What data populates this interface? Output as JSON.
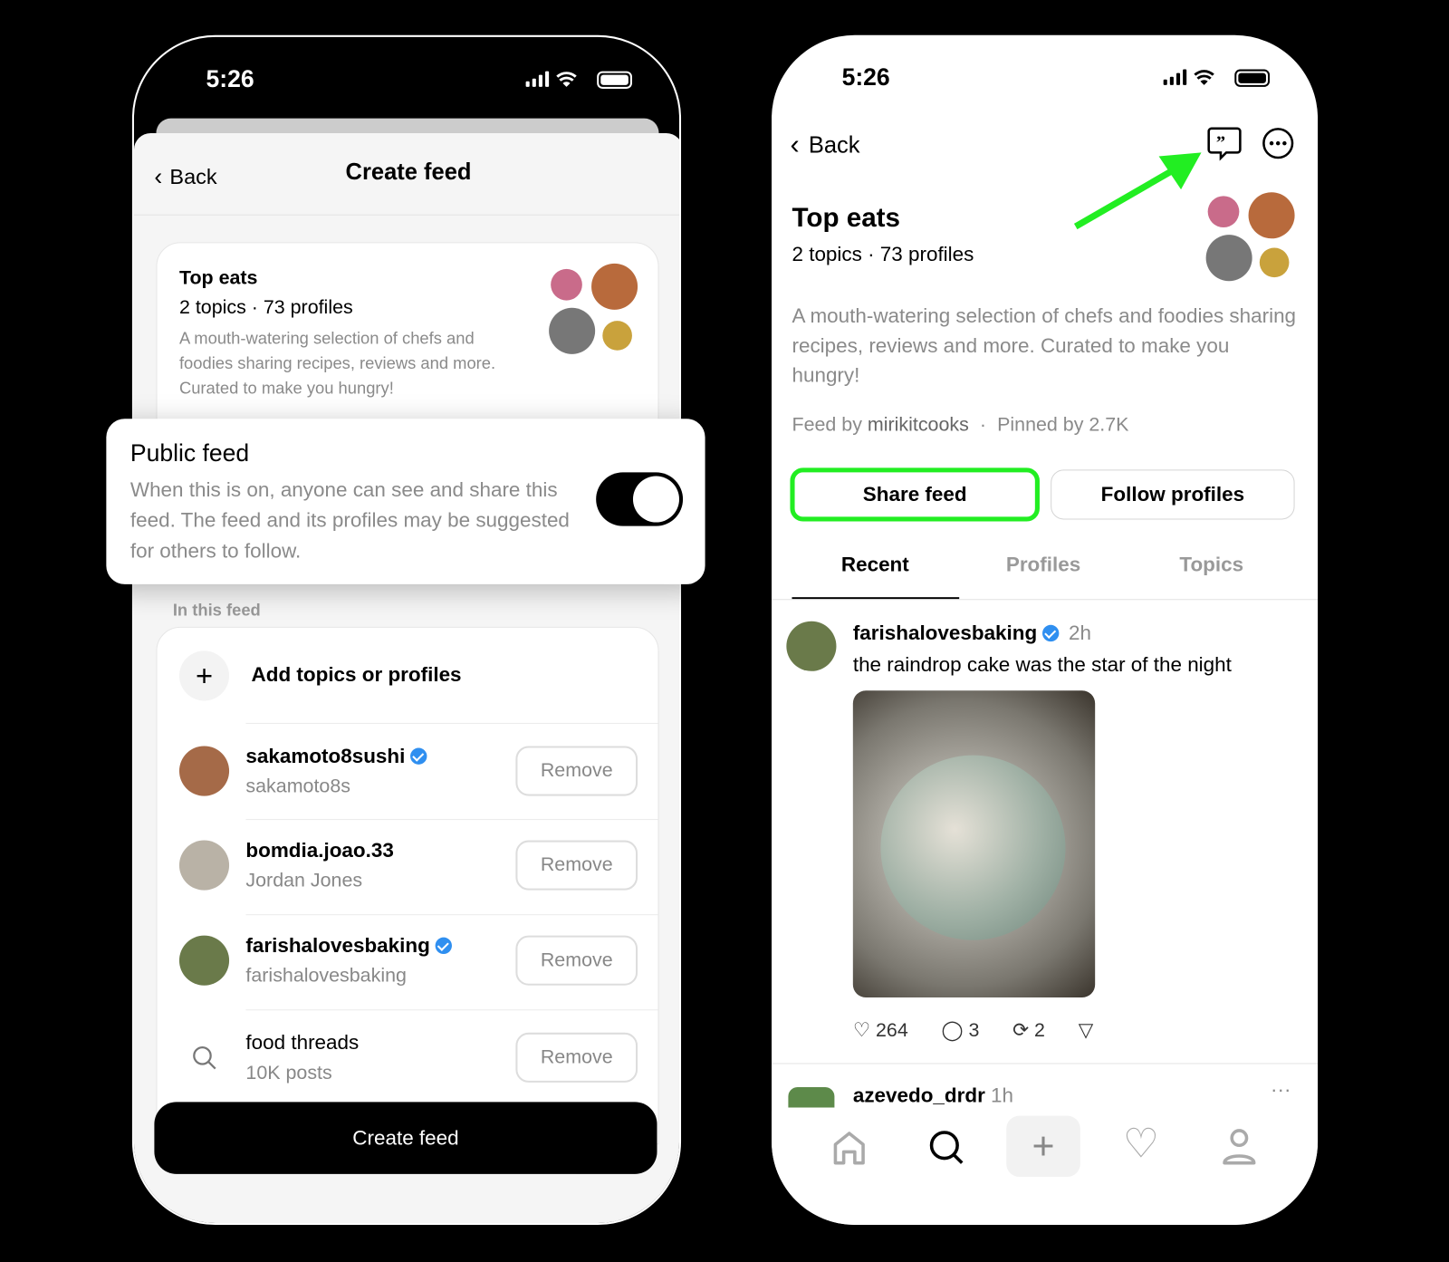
{
  "left_phone": {
    "status_time": "5:26",
    "header": {
      "back_label": "Back",
      "title": "Create feed"
    },
    "feed_card": {
      "title": "Top eats",
      "meta": "2 topics · 73 profiles",
      "description": "A mouth-watering selection of chefs and foodies sharing recipes, reviews and more. Curated to make you hungry!"
    },
    "public_feed": {
      "title": "Public feed",
      "description": "When this is on, anyone can see and share this feed. The feed and its profiles may be suggested for others to follow.",
      "toggle_on": true
    },
    "section_label": "In this feed",
    "add_label": "Add topics or profiles",
    "items": [
      {
        "name": "sakamoto8sushi",
        "sub": "sakamoto8s",
        "verified": true,
        "action": "Remove",
        "icon": "avatar"
      },
      {
        "name": "bomdia.joao.33",
        "sub": "Jordan Jones",
        "verified": false,
        "action": "Remove",
        "icon": "avatar"
      },
      {
        "name": "farishalovesbaking",
        "sub": "farishalovesbaking",
        "verified": true,
        "action": "Remove",
        "icon": "avatar"
      },
      {
        "name": "food threads",
        "sub": "10K posts",
        "verified": false,
        "action": "Remove",
        "icon": "search-icon"
      }
    ],
    "create_button": "Create feed"
  },
  "right_phone": {
    "status_time": "5:26",
    "header": {
      "back_label": "Back"
    },
    "feed": {
      "title": "Top eats",
      "meta": "2 topics · 73 profiles",
      "description": "A mouth-watering selection of chefs and foodies sharing recipes, reviews and more. Curated to make you hungry!",
      "feed_by_label": "Feed by",
      "author": "mirikitcooks",
      "separator": "·",
      "pinned": "Pinned by 2.7K"
    },
    "share_button": "Share feed",
    "follow_button": "Follow profiles",
    "tabs": [
      {
        "label": "Recent",
        "active": true
      },
      {
        "label": "Profiles"
      },
      {
        "label": "Topics"
      }
    ],
    "post": {
      "author": "farishalovesbaking",
      "verified": true,
      "time": "2h",
      "text": "the raindrop cake was the star of the night",
      "likes": "264",
      "comments": "3",
      "reposts": "2"
    },
    "next_post": {
      "author": "azevedo_drdr",
      "time": "1h"
    },
    "highlight_color": "#22ee22"
  }
}
